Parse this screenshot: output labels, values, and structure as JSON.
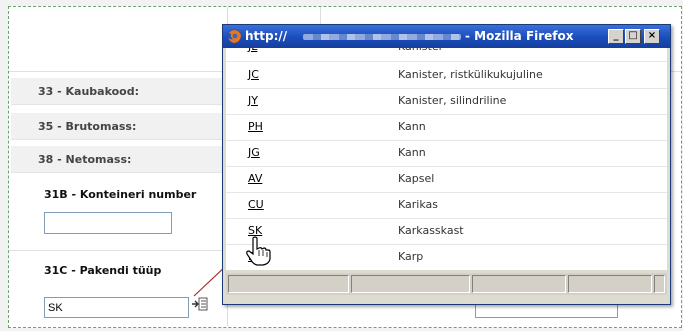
{
  "form": {
    "fields": [
      {
        "label": "33 - Kaubakood:"
      },
      {
        "label": "35 - Brutomass:"
      },
      {
        "label": "38 - Netomass:"
      }
    ],
    "container_number": {
      "label": "31B - Konteineri number",
      "value": ""
    },
    "package_type": {
      "label": "31C - Pakendi tüüp",
      "value": "SK"
    }
  },
  "popup": {
    "title_prefix": "http://",
    "title_suffix": " - Mozilla Firefox",
    "buttons": {
      "minimize": "_",
      "maximize": "□",
      "close": "×"
    },
    "rows": [
      {
        "code": "JC",
        "description": "Kanister, ristkülikukujuline"
      },
      {
        "code": "JY",
        "description": "Kanister, silindriline"
      },
      {
        "code": "PH",
        "description": "Kann"
      },
      {
        "code": "JG",
        "description": "Kann"
      },
      {
        "code": "AV",
        "description": "Kapsel"
      },
      {
        "code": "CU",
        "description": "Karikas"
      },
      {
        "code": "SK",
        "description": "Karkasskast"
      },
      {
        "code": "BX",
        "description": "Karp"
      }
    ]
  },
  "colors": {
    "titlebar": "#1a4dbb",
    "form_border": "#6ca36c",
    "input_border": "#7f9db9",
    "arrow_line": "#a03030"
  }
}
